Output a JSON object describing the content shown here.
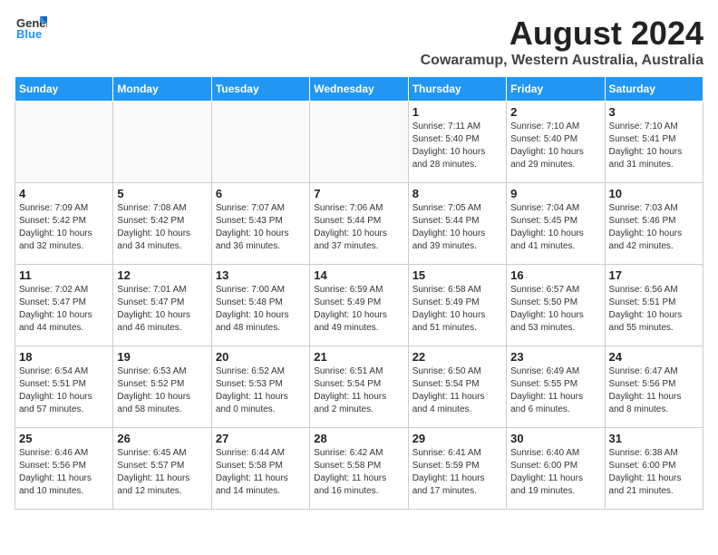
{
  "header": {
    "logo": {
      "general": "General",
      "blue": "Blue"
    },
    "title": "August 2024",
    "subtitle": "Cowaramup, Western Australia, Australia"
  },
  "days_of_week": [
    "Sunday",
    "Monday",
    "Tuesday",
    "Wednesday",
    "Thursday",
    "Friday",
    "Saturday"
  ],
  "weeks": [
    [
      {
        "day": "",
        "info": ""
      },
      {
        "day": "",
        "info": ""
      },
      {
        "day": "",
        "info": ""
      },
      {
        "day": "",
        "info": ""
      },
      {
        "day": "1",
        "info": "Sunrise: 7:11 AM\nSunset: 5:40 PM\nDaylight: 10 hours\nand 28 minutes."
      },
      {
        "day": "2",
        "info": "Sunrise: 7:10 AM\nSunset: 5:40 PM\nDaylight: 10 hours\nand 29 minutes."
      },
      {
        "day": "3",
        "info": "Sunrise: 7:10 AM\nSunset: 5:41 PM\nDaylight: 10 hours\nand 31 minutes."
      }
    ],
    [
      {
        "day": "4",
        "info": "Sunrise: 7:09 AM\nSunset: 5:42 PM\nDaylight: 10 hours\nand 32 minutes."
      },
      {
        "day": "5",
        "info": "Sunrise: 7:08 AM\nSunset: 5:42 PM\nDaylight: 10 hours\nand 34 minutes."
      },
      {
        "day": "6",
        "info": "Sunrise: 7:07 AM\nSunset: 5:43 PM\nDaylight: 10 hours\nand 36 minutes."
      },
      {
        "day": "7",
        "info": "Sunrise: 7:06 AM\nSunset: 5:44 PM\nDaylight: 10 hours\nand 37 minutes."
      },
      {
        "day": "8",
        "info": "Sunrise: 7:05 AM\nSunset: 5:44 PM\nDaylight: 10 hours\nand 39 minutes."
      },
      {
        "day": "9",
        "info": "Sunrise: 7:04 AM\nSunset: 5:45 PM\nDaylight: 10 hours\nand 41 minutes."
      },
      {
        "day": "10",
        "info": "Sunrise: 7:03 AM\nSunset: 5:46 PM\nDaylight: 10 hours\nand 42 minutes."
      }
    ],
    [
      {
        "day": "11",
        "info": "Sunrise: 7:02 AM\nSunset: 5:47 PM\nDaylight: 10 hours\nand 44 minutes."
      },
      {
        "day": "12",
        "info": "Sunrise: 7:01 AM\nSunset: 5:47 PM\nDaylight: 10 hours\nand 46 minutes."
      },
      {
        "day": "13",
        "info": "Sunrise: 7:00 AM\nSunset: 5:48 PM\nDaylight: 10 hours\nand 48 minutes."
      },
      {
        "day": "14",
        "info": "Sunrise: 6:59 AM\nSunset: 5:49 PM\nDaylight: 10 hours\nand 49 minutes."
      },
      {
        "day": "15",
        "info": "Sunrise: 6:58 AM\nSunset: 5:49 PM\nDaylight: 10 hours\nand 51 minutes."
      },
      {
        "day": "16",
        "info": "Sunrise: 6:57 AM\nSunset: 5:50 PM\nDaylight: 10 hours\nand 53 minutes."
      },
      {
        "day": "17",
        "info": "Sunrise: 6:56 AM\nSunset: 5:51 PM\nDaylight: 10 hours\nand 55 minutes."
      }
    ],
    [
      {
        "day": "18",
        "info": "Sunrise: 6:54 AM\nSunset: 5:51 PM\nDaylight: 10 hours\nand 57 minutes."
      },
      {
        "day": "19",
        "info": "Sunrise: 6:53 AM\nSunset: 5:52 PM\nDaylight: 10 hours\nand 58 minutes."
      },
      {
        "day": "20",
        "info": "Sunrise: 6:52 AM\nSunset: 5:53 PM\nDaylight: 11 hours\nand 0 minutes."
      },
      {
        "day": "21",
        "info": "Sunrise: 6:51 AM\nSunset: 5:54 PM\nDaylight: 11 hours\nand 2 minutes."
      },
      {
        "day": "22",
        "info": "Sunrise: 6:50 AM\nSunset: 5:54 PM\nDaylight: 11 hours\nand 4 minutes."
      },
      {
        "day": "23",
        "info": "Sunrise: 6:49 AM\nSunset: 5:55 PM\nDaylight: 11 hours\nand 6 minutes."
      },
      {
        "day": "24",
        "info": "Sunrise: 6:47 AM\nSunset: 5:56 PM\nDaylight: 11 hours\nand 8 minutes."
      }
    ],
    [
      {
        "day": "25",
        "info": "Sunrise: 6:46 AM\nSunset: 5:56 PM\nDaylight: 11 hours\nand 10 minutes."
      },
      {
        "day": "26",
        "info": "Sunrise: 6:45 AM\nSunset: 5:57 PM\nDaylight: 11 hours\nand 12 minutes."
      },
      {
        "day": "27",
        "info": "Sunrise: 6:44 AM\nSunset: 5:58 PM\nDaylight: 11 hours\nand 14 minutes."
      },
      {
        "day": "28",
        "info": "Sunrise: 6:42 AM\nSunset: 5:58 PM\nDaylight: 11 hours\nand 16 minutes."
      },
      {
        "day": "29",
        "info": "Sunrise: 6:41 AM\nSunset: 5:59 PM\nDaylight: 11 hours\nand 17 minutes."
      },
      {
        "day": "30",
        "info": "Sunrise: 6:40 AM\nSunset: 6:00 PM\nDaylight: 11 hours\nand 19 minutes."
      },
      {
        "day": "31",
        "info": "Sunrise: 6:38 AM\nSunset: 6:00 PM\nDaylight: 11 hours\nand 21 minutes."
      }
    ]
  ]
}
